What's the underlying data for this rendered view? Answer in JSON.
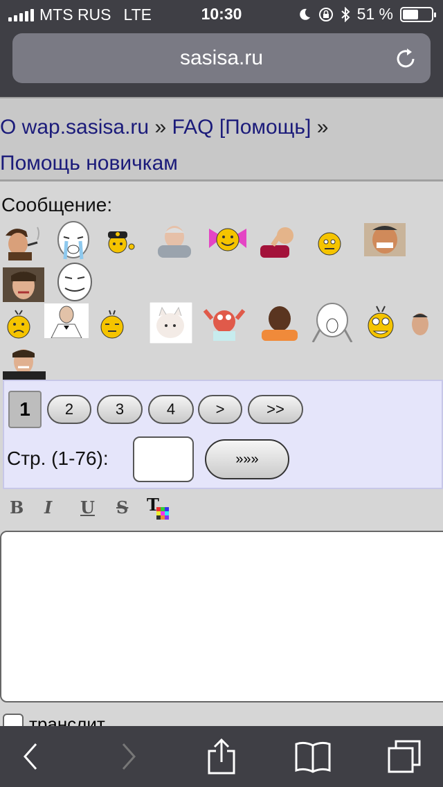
{
  "status": {
    "carrier": "MTS RUS",
    "network": "LTE",
    "time": "10:30",
    "battery": "51 %"
  },
  "browser": {
    "url": "sasisa.ru"
  },
  "breadcrumb": {
    "item1": "О wap.sasisa.ru",
    "item2": "FAQ [Помощь]",
    "item3": "Помощь новичкам",
    "separator": "»"
  },
  "form": {
    "message_label": "Сообщение:",
    "translit_label": "транслит"
  },
  "pagination": {
    "current": "1",
    "pages": [
      "2",
      "3",
      "4",
      ">",
      ">>"
    ],
    "page_label": "Стр. (1-76):",
    "go_label": "»»»"
  },
  "formatting": {
    "bold": "B",
    "italic": "I",
    "underline": "U",
    "strike": "S",
    "color": "T"
  },
  "colors": {
    "chrome": "#3f3f45",
    "link": "#1b1b7a",
    "pager_bg": "#e5e5fa"
  }
}
